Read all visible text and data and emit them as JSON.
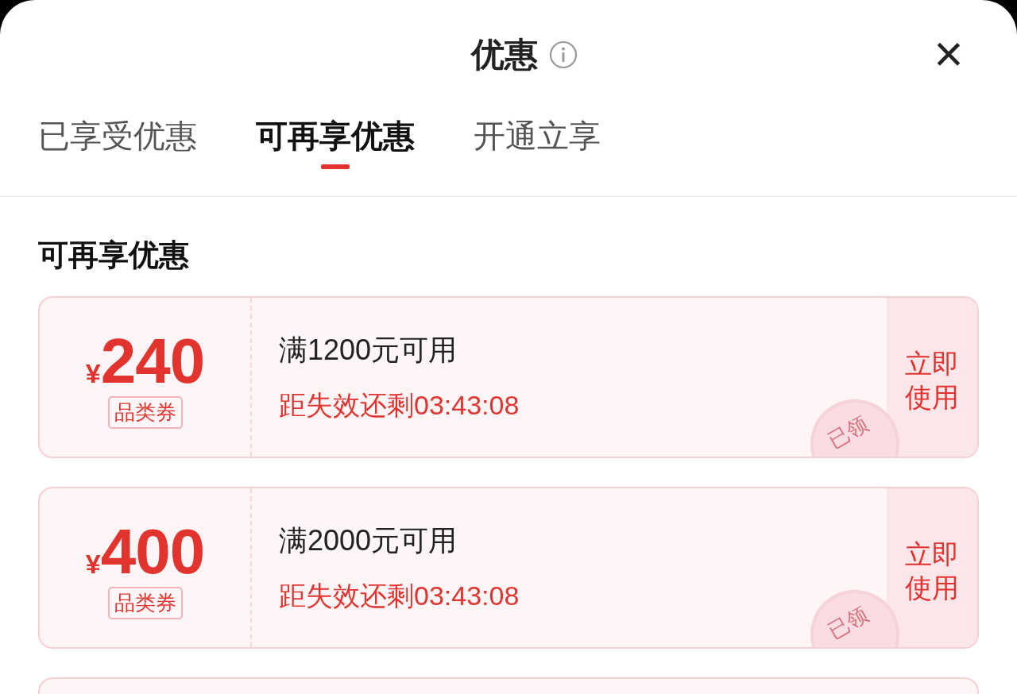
{
  "sheet": {
    "title": "优惠",
    "close": "×"
  },
  "tabs": [
    {
      "label": "已享受优惠",
      "selected": false
    },
    {
      "label": "可再享优惠",
      "selected": true
    },
    {
      "label": "开通立享",
      "selected": false
    }
  ],
  "section_title": "可再享优惠",
  "coupons": [
    {
      "currency": "¥",
      "amount": "240",
      "type": "品类券",
      "condition": "满1200元可用",
      "countdown": "距失效还剩03:43:08",
      "action": "立即使用",
      "claimed": true,
      "stamp": "已领"
    },
    {
      "currency": "¥",
      "amount": "400",
      "type": "品类券",
      "condition": "满2000元可用",
      "countdown": "距失效还剩03:43:08",
      "action": "立即使用",
      "claimed": true,
      "stamp": "已领"
    }
  ],
  "more_below": true
}
